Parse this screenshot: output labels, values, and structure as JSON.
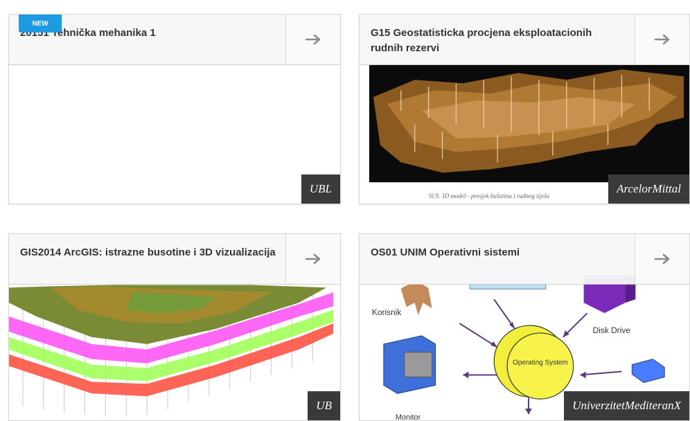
{
  "courses": [
    {
      "title": "20151 Tehnička mehanika 1",
      "org": "UBL",
      "new_badge": "NEW"
    },
    {
      "title": "G15 Geostatisticka procjena eksploatacionih rudnih rezervi",
      "org": "ArcelorMittal",
      "caption": "Sl.9. 3D model - presjek bušotina i rudnog tijela"
    },
    {
      "title": "GIS2014 ArcGIS: istrazne busotine i 3D vizualizacija",
      "org": "UB"
    },
    {
      "title": "OS01 UNIM Operativni sistemi",
      "org": "UniverzitetMediteranX",
      "diagram": {
        "user": "Korisnik",
        "disk": "Disk Drive",
        "os": "Operating System",
        "monitor": "Monitor"
      }
    }
  ],
  "icons": {
    "arrow": "arrow-right-icon"
  },
  "colors": {
    "new_badge": "#1e9be0",
    "org_badge": "#3a3a3a"
  }
}
